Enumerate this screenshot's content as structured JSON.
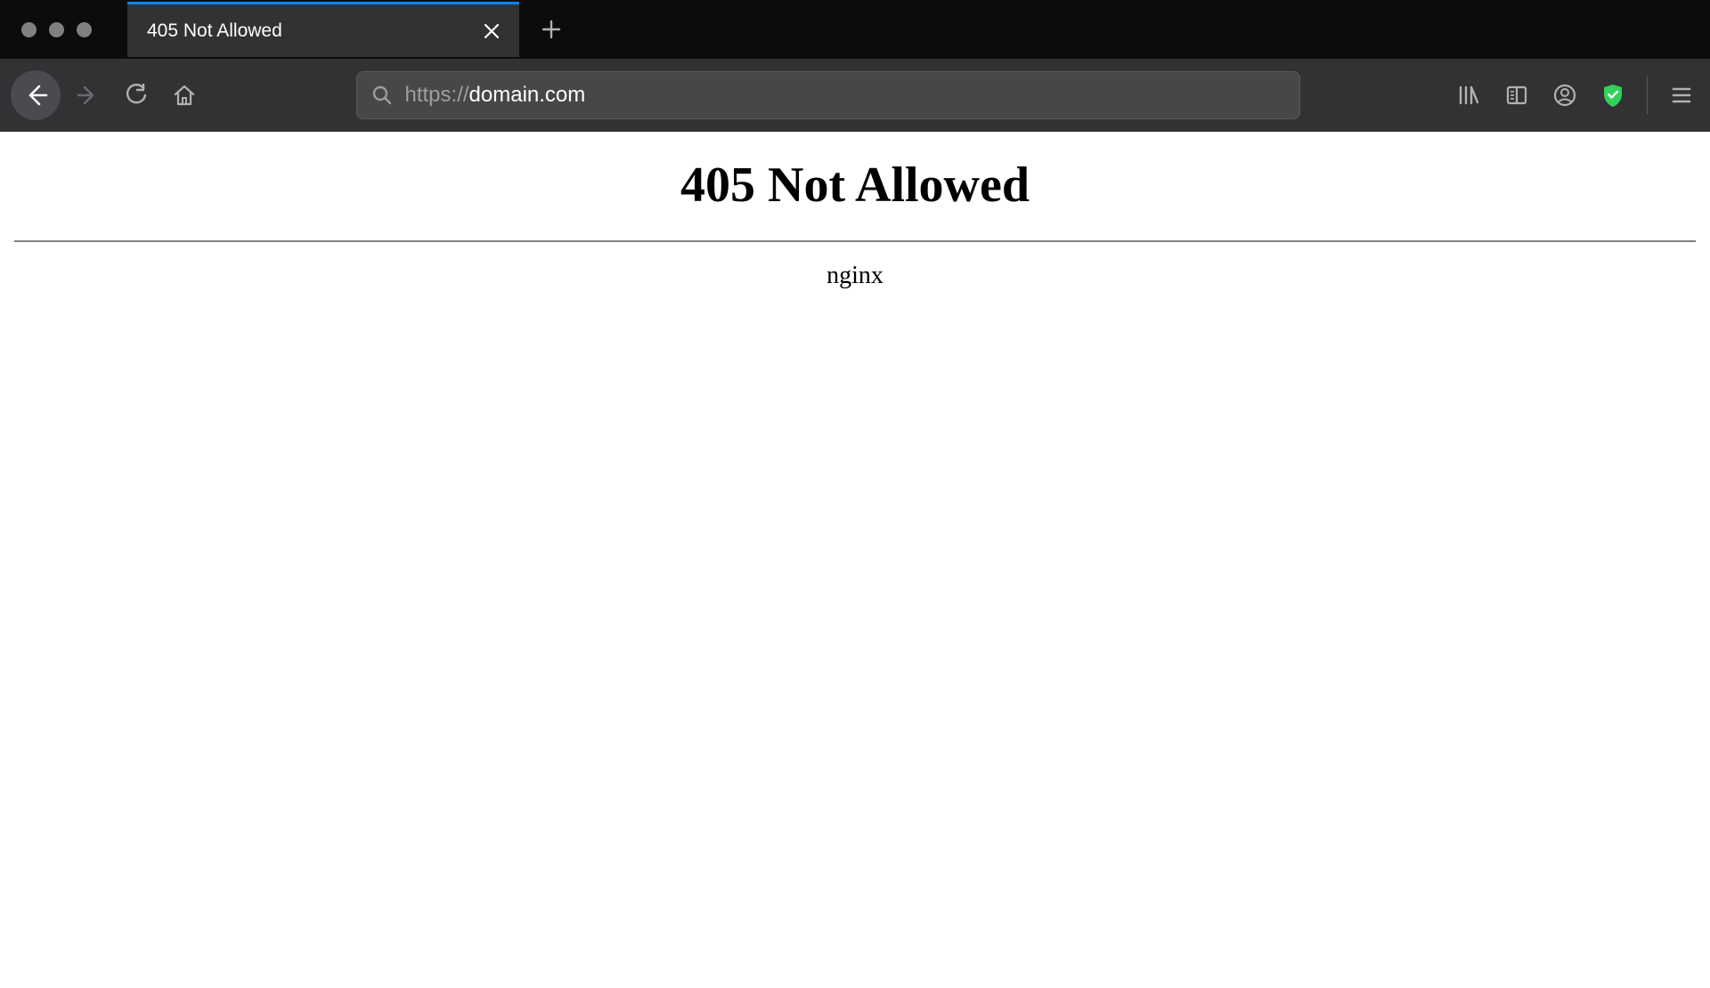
{
  "tab": {
    "title": "405 Not Allowed"
  },
  "address": {
    "protocol": "https://",
    "domain": "domain.com"
  },
  "page": {
    "heading": "405 Not Allowed",
    "server": "nginx"
  }
}
